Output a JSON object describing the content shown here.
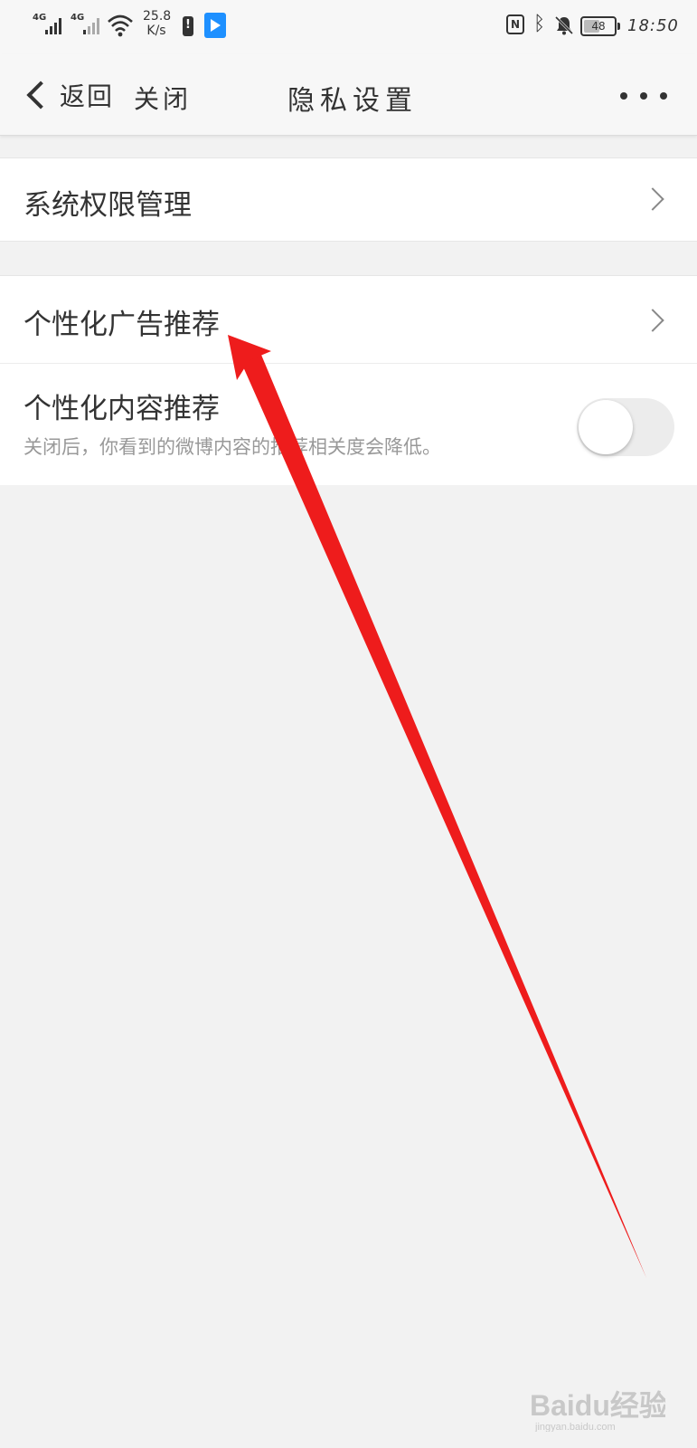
{
  "status_bar": {
    "signal_1": "4G",
    "signal_2": "4G",
    "speed_value": "25.8",
    "speed_unit": "K/s",
    "battery_level": "48",
    "time": "18:50",
    "nfc": "N"
  },
  "nav": {
    "back_label": "返回",
    "close_label": "关闭",
    "title": "隐私设置"
  },
  "settings": {
    "system_permissions": "系统权限管理",
    "personalized_ads": "个性化广告推荐",
    "personalized_content": {
      "label": "个性化内容推荐",
      "description": "关闭后，你看到的微博内容的推荐相关度会降低。",
      "enabled": false
    }
  },
  "colors": {
    "annotation_red": "#ee1c1c",
    "toggle_off": "#ececec",
    "background": "#f2f2f2"
  },
  "watermark": {
    "text": "Baidu经验",
    "subtext": "jingyan.baidu.com"
  }
}
